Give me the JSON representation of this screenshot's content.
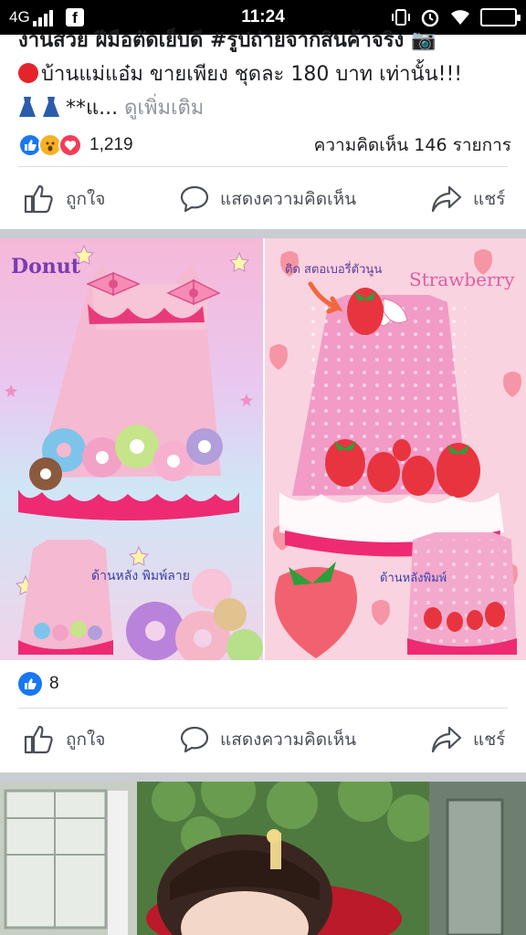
{
  "status_bar": {
    "network": "4G",
    "time": "11:24"
  },
  "post1": {
    "text_line1": "งานสวย ฝีมือตัดเย็บดี #รูปถ่ายจากสินค้าจริง 📷",
    "text_line2": "บ้านแม่แอ๋ม ขายเพียง ชุดละ 180 บาท เท่านั้น!!!",
    "text_line3_start": "**แ...",
    "see_more": "ดูเพิ่มเติม",
    "reaction_count": "1,219",
    "comment_count": "ความคิดเห็น 146 รายการ"
  },
  "actions": {
    "like": "ถูกใจ",
    "comment": "แสดงความคิดเห็น",
    "share": "แชร์"
  },
  "post2": {
    "image_labels": {
      "left_title": "Donut",
      "right_title": "Strawberry",
      "sticker_note": "ติด สตอเบอรี่ตัวนูน",
      "left_back": "ด้านหลัง พิมพ์ลาย",
      "right_back": "ด้านหลังพิมพ์"
    },
    "reaction_count": "8"
  },
  "colors": {
    "like_blue": "#1877f2",
    "action_gray": "#4b4f56",
    "divider": "#dadde1"
  }
}
